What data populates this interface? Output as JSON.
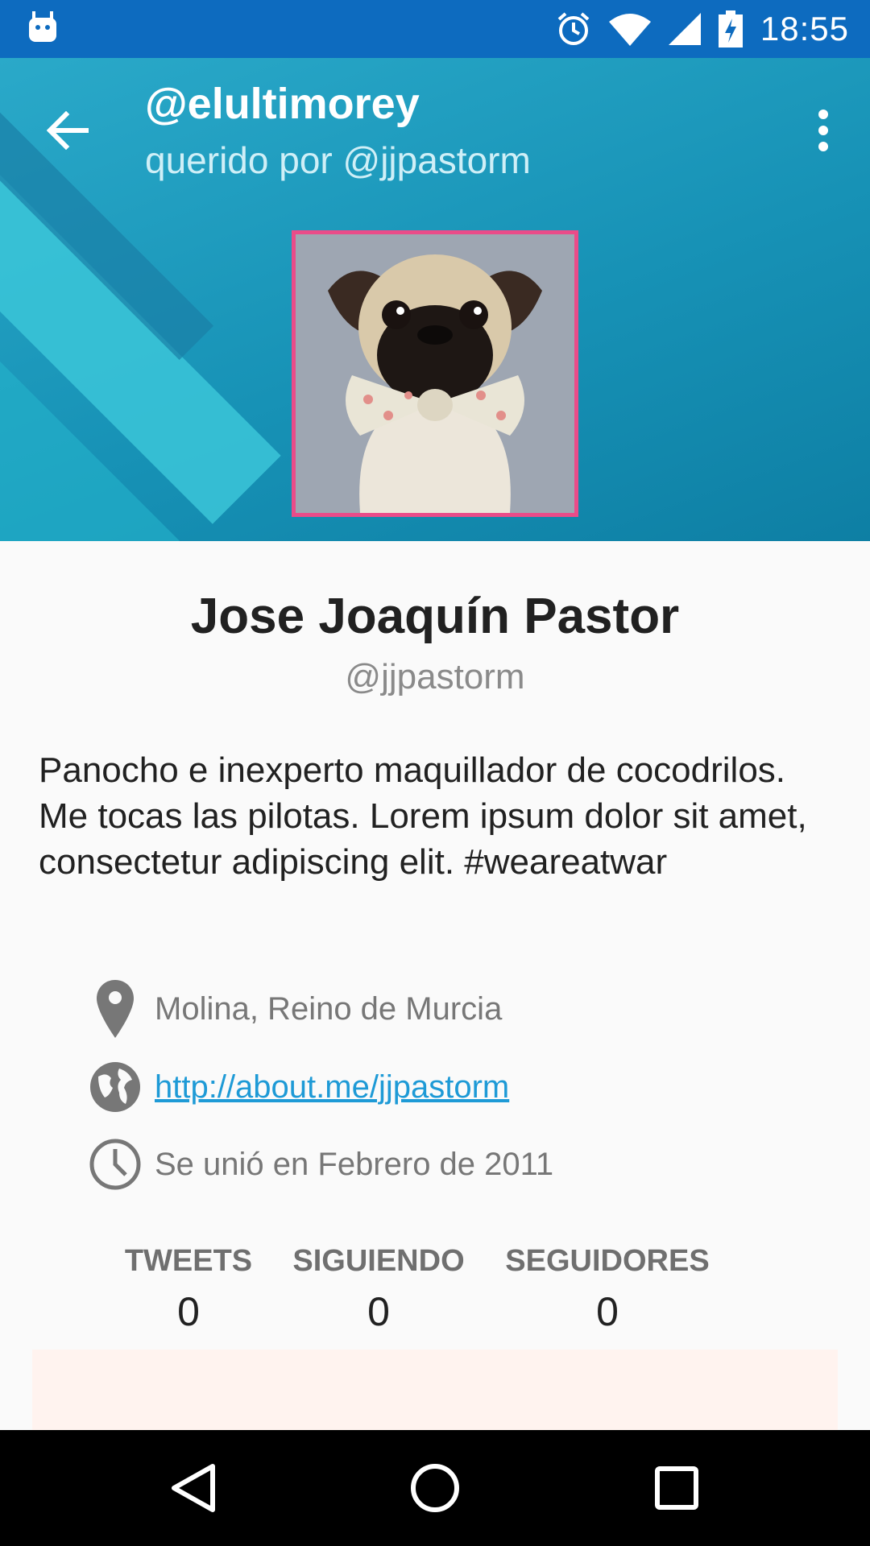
{
  "status_bar": {
    "time": "18:55",
    "icons": [
      "android-debug-icon",
      "alarm-icon",
      "wifi-icon",
      "signal-icon",
      "battery-charging-icon"
    ]
  },
  "header": {
    "title": "@elultimorey",
    "subtitle": "querido por @jjpastorm",
    "back_icon": "arrow-back-icon",
    "menu_icon": "more-vert-icon",
    "avatar_border_color": "#ea4c89"
  },
  "profile": {
    "name": "Jose Joaquín Pastor",
    "handle": "@jjpastorm",
    "bio": "Panocho e inexperto maquillador de cocodrilos. Me tocas las pilotas. Lorem ipsum dolor sit amet, consectetur adipiscing elit. #weareatwar",
    "location": "Molina, Reino de Murcia",
    "website": "http://about.me/jjpastorm",
    "joined": "Se unió en Febrero de 2011"
  },
  "stats": {
    "tweets_label": "TWEETS",
    "tweets_value": "0",
    "following_label": "SIGUIENDO",
    "following_value": "0",
    "followers_label": "SEGUIDORES",
    "followers_value": "0"
  },
  "colors": {
    "status_bar": "#0d6bbf",
    "link": "#1e9ad6",
    "accent": "#ea4c89"
  }
}
